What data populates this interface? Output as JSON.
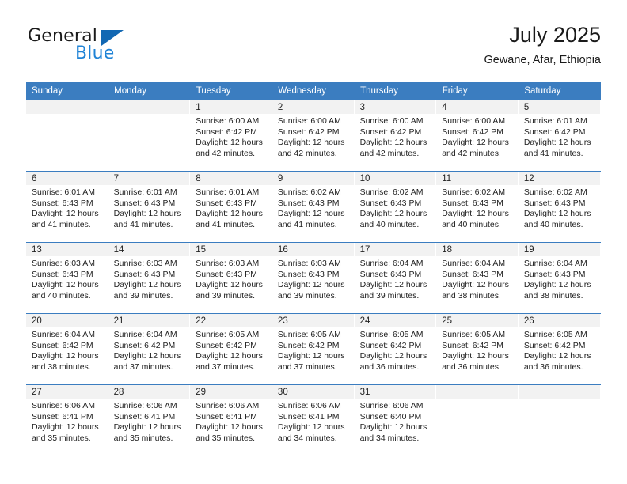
{
  "brand": {
    "name_part1": "General",
    "name_part2": "Blue",
    "triangle_color": "#1268b3",
    "blue_text_color": "#1f83d6"
  },
  "header": {
    "title": "July 2025",
    "subtitle": "Gewane, Afar, Ethiopia"
  },
  "theme": {
    "header_row_bg": "#3b7dc0",
    "header_row_text": "#ffffff",
    "daynum_band_bg": "#f2f2f2",
    "row_separator": "#3b7dc0"
  },
  "calendar": {
    "weekday_headers": [
      "Sunday",
      "Monday",
      "Tuesday",
      "Wednesday",
      "Thursday",
      "Friday",
      "Saturday"
    ],
    "labels": {
      "sunrise_prefix": "Sunrise:",
      "sunset_prefix": "Sunset:",
      "daylight_prefix": "Daylight:"
    },
    "weeks": [
      [
        {
          "day": "",
          "sunrise": "",
          "sunset": "",
          "daylight": "",
          "empty": true
        },
        {
          "day": "",
          "sunrise": "",
          "sunset": "",
          "daylight": "",
          "empty": true
        },
        {
          "day": "1",
          "sunrise": "Sunrise: 6:00 AM",
          "sunset": "Sunset: 6:42 PM",
          "daylight_l1": "Daylight: 12 hours",
          "daylight_l2": "and 42 minutes."
        },
        {
          "day": "2",
          "sunrise": "Sunrise: 6:00 AM",
          "sunset": "Sunset: 6:42 PM",
          "daylight_l1": "Daylight: 12 hours",
          "daylight_l2": "and 42 minutes."
        },
        {
          "day": "3",
          "sunrise": "Sunrise: 6:00 AM",
          "sunset": "Sunset: 6:42 PM",
          "daylight_l1": "Daylight: 12 hours",
          "daylight_l2": "and 42 minutes."
        },
        {
          "day": "4",
          "sunrise": "Sunrise: 6:00 AM",
          "sunset": "Sunset: 6:42 PM",
          "daylight_l1": "Daylight: 12 hours",
          "daylight_l2": "and 42 minutes."
        },
        {
          "day": "5",
          "sunrise": "Sunrise: 6:01 AM",
          "sunset": "Sunset: 6:42 PM",
          "daylight_l1": "Daylight: 12 hours",
          "daylight_l2": "and 41 minutes."
        }
      ],
      [
        {
          "day": "6",
          "sunrise": "Sunrise: 6:01 AM",
          "sunset": "Sunset: 6:43 PM",
          "daylight_l1": "Daylight: 12 hours",
          "daylight_l2": "and 41 minutes."
        },
        {
          "day": "7",
          "sunrise": "Sunrise: 6:01 AM",
          "sunset": "Sunset: 6:43 PM",
          "daylight_l1": "Daylight: 12 hours",
          "daylight_l2": "and 41 minutes."
        },
        {
          "day": "8",
          "sunrise": "Sunrise: 6:01 AM",
          "sunset": "Sunset: 6:43 PM",
          "daylight_l1": "Daylight: 12 hours",
          "daylight_l2": "and 41 minutes."
        },
        {
          "day": "9",
          "sunrise": "Sunrise: 6:02 AM",
          "sunset": "Sunset: 6:43 PM",
          "daylight_l1": "Daylight: 12 hours",
          "daylight_l2": "and 41 minutes."
        },
        {
          "day": "10",
          "sunrise": "Sunrise: 6:02 AM",
          "sunset": "Sunset: 6:43 PM",
          "daylight_l1": "Daylight: 12 hours",
          "daylight_l2": "and 40 minutes."
        },
        {
          "day": "11",
          "sunrise": "Sunrise: 6:02 AM",
          "sunset": "Sunset: 6:43 PM",
          "daylight_l1": "Daylight: 12 hours",
          "daylight_l2": "and 40 minutes."
        },
        {
          "day": "12",
          "sunrise": "Sunrise: 6:02 AM",
          "sunset": "Sunset: 6:43 PM",
          "daylight_l1": "Daylight: 12 hours",
          "daylight_l2": "and 40 minutes."
        }
      ],
      [
        {
          "day": "13",
          "sunrise": "Sunrise: 6:03 AM",
          "sunset": "Sunset: 6:43 PM",
          "daylight_l1": "Daylight: 12 hours",
          "daylight_l2": "and 40 minutes."
        },
        {
          "day": "14",
          "sunrise": "Sunrise: 6:03 AM",
          "sunset": "Sunset: 6:43 PM",
          "daylight_l1": "Daylight: 12 hours",
          "daylight_l2": "and 39 minutes."
        },
        {
          "day": "15",
          "sunrise": "Sunrise: 6:03 AM",
          "sunset": "Sunset: 6:43 PM",
          "daylight_l1": "Daylight: 12 hours",
          "daylight_l2": "and 39 minutes."
        },
        {
          "day": "16",
          "sunrise": "Sunrise: 6:03 AM",
          "sunset": "Sunset: 6:43 PM",
          "daylight_l1": "Daylight: 12 hours",
          "daylight_l2": "and 39 minutes."
        },
        {
          "day": "17",
          "sunrise": "Sunrise: 6:04 AM",
          "sunset": "Sunset: 6:43 PM",
          "daylight_l1": "Daylight: 12 hours",
          "daylight_l2": "and 39 minutes."
        },
        {
          "day": "18",
          "sunrise": "Sunrise: 6:04 AM",
          "sunset": "Sunset: 6:43 PM",
          "daylight_l1": "Daylight: 12 hours",
          "daylight_l2": "and 38 minutes."
        },
        {
          "day": "19",
          "sunrise": "Sunrise: 6:04 AM",
          "sunset": "Sunset: 6:43 PM",
          "daylight_l1": "Daylight: 12 hours",
          "daylight_l2": "and 38 minutes."
        }
      ],
      [
        {
          "day": "20",
          "sunrise": "Sunrise: 6:04 AM",
          "sunset": "Sunset: 6:42 PM",
          "daylight_l1": "Daylight: 12 hours",
          "daylight_l2": "and 38 minutes."
        },
        {
          "day": "21",
          "sunrise": "Sunrise: 6:04 AM",
          "sunset": "Sunset: 6:42 PM",
          "daylight_l1": "Daylight: 12 hours",
          "daylight_l2": "and 37 minutes."
        },
        {
          "day": "22",
          "sunrise": "Sunrise: 6:05 AM",
          "sunset": "Sunset: 6:42 PM",
          "daylight_l1": "Daylight: 12 hours",
          "daylight_l2": "and 37 minutes."
        },
        {
          "day": "23",
          "sunrise": "Sunrise: 6:05 AM",
          "sunset": "Sunset: 6:42 PM",
          "daylight_l1": "Daylight: 12 hours",
          "daylight_l2": "and 37 minutes."
        },
        {
          "day": "24",
          "sunrise": "Sunrise: 6:05 AM",
          "sunset": "Sunset: 6:42 PM",
          "daylight_l1": "Daylight: 12 hours",
          "daylight_l2": "and 36 minutes."
        },
        {
          "day": "25",
          "sunrise": "Sunrise: 6:05 AM",
          "sunset": "Sunset: 6:42 PM",
          "daylight_l1": "Daylight: 12 hours",
          "daylight_l2": "and 36 minutes."
        },
        {
          "day": "26",
          "sunrise": "Sunrise: 6:05 AM",
          "sunset": "Sunset: 6:42 PM",
          "daylight_l1": "Daylight: 12 hours",
          "daylight_l2": "and 36 minutes."
        }
      ],
      [
        {
          "day": "27",
          "sunrise": "Sunrise: 6:06 AM",
          "sunset": "Sunset: 6:41 PM",
          "daylight_l1": "Daylight: 12 hours",
          "daylight_l2": "and 35 minutes."
        },
        {
          "day": "28",
          "sunrise": "Sunrise: 6:06 AM",
          "sunset": "Sunset: 6:41 PM",
          "daylight_l1": "Daylight: 12 hours",
          "daylight_l2": "and 35 minutes."
        },
        {
          "day": "29",
          "sunrise": "Sunrise: 6:06 AM",
          "sunset": "Sunset: 6:41 PM",
          "daylight_l1": "Daylight: 12 hours",
          "daylight_l2": "and 35 minutes."
        },
        {
          "day": "30",
          "sunrise": "Sunrise: 6:06 AM",
          "sunset": "Sunset: 6:41 PM",
          "daylight_l1": "Daylight: 12 hours",
          "daylight_l2": "and 34 minutes."
        },
        {
          "day": "31",
          "sunrise": "Sunrise: 6:06 AM",
          "sunset": "Sunset: 6:40 PM",
          "daylight_l1": "Daylight: 12 hours",
          "daylight_l2": "and 34 minutes."
        },
        {
          "day": "",
          "sunrise": "",
          "sunset": "",
          "daylight": "",
          "empty": true
        },
        {
          "day": "",
          "sunrise": "",
          "sunset": "",
          "daylight": "",
          "empty": true
        }
      ]
    ]
  }
}
